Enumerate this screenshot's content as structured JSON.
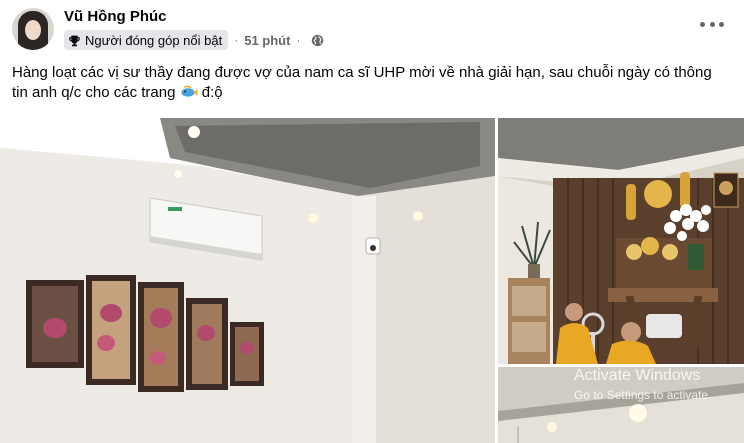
{
  "post": {
    "author": "Vũ Hồng Phúc",
    "badge_label": "Người đóng góp nổi bật",
    "separator": "·",
    "time": "51 phút",
    "text_before_emoji": "Hàng loạt các vị sư thầy đang được vợ của nam ca sĩ UHP mời về nhà giải hạn, sau chuỗi ngày có thông tin anh q/c cho các trang ",
    "text_after_emoji": " đ:ộ"
  },
  "icons": {
    "badge": "trophy-icon",
    "privacy": "globe-icon",
    "more": "more-options-icon",
    "emoji": "fish-emoji-icon"
  },
  "watermark": {
    "line1": "Activate Windows",
    "line2": "Go to Settings to activate"
  },
  "colors": {
    "name": "#050505",
    "meta": "#65676b",
    "badge_bg": "#e4e6eb"
  }
}
